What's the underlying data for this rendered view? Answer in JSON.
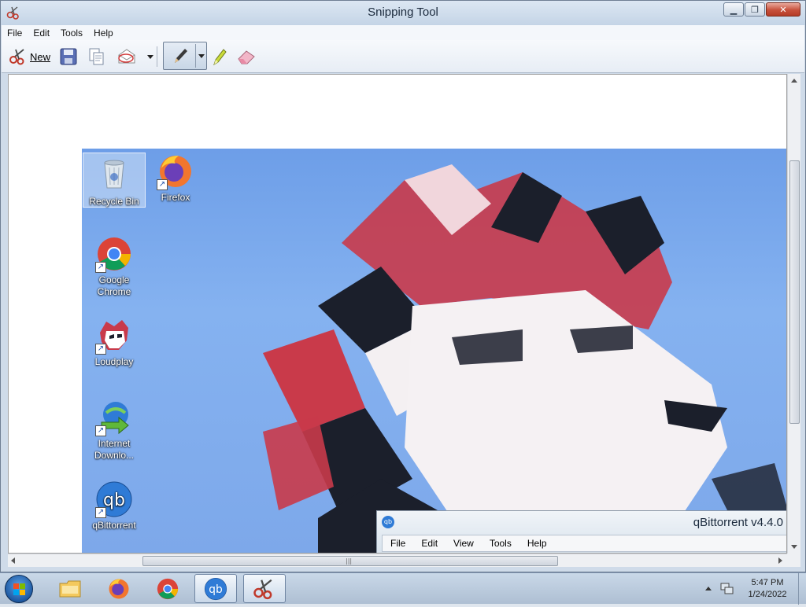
{
  "window": {
    "title": "Snipping Tool"
  },
  "menu": {
    "items": [
      "File",
      "Edit",
      "Tools",
      "Help"
    ]
  },
  "toolbar": {
    "new_label": "New"
  },
  "desktop": {
    "icons": [
      {
        "label_line1": "Recycle Bin",
        "label_line2": ""
      },
      {
        "label_line1": "Firefox",
        "label_line2": ""
      },
      {
        "label_line1": "Google",
        "label_line2": "Chrome"
      },
      {
        "label_line1": "Loudplay",
        "label_line2": ""
      },
      {
        "label_line1": "Internet",
        "label_line2": "Downlo..."
      },
      {
        "label_line1": "qBittorrent",
        "label_line2": ""
      }
    ]
  },
  "qbittorrent": {
    "title": "qBittorrent v4.4.0",
    "icon_text": "qb",
    "menu": [
      "File",
      "Edit",
      "View",
      "Tools",
      "Help"
    ]
  },
  "taskbar": {
    "qb_text": "qb"
  },
  "clock": {
    "time": "5:47 PM",
    "date": "1/24/2022"
  },
  "colors": {
    "desktop_bg": "#7da8ea",
    "title_bg": "#dce7f3",
    "close_btn": "#c7503b"
  }
}
